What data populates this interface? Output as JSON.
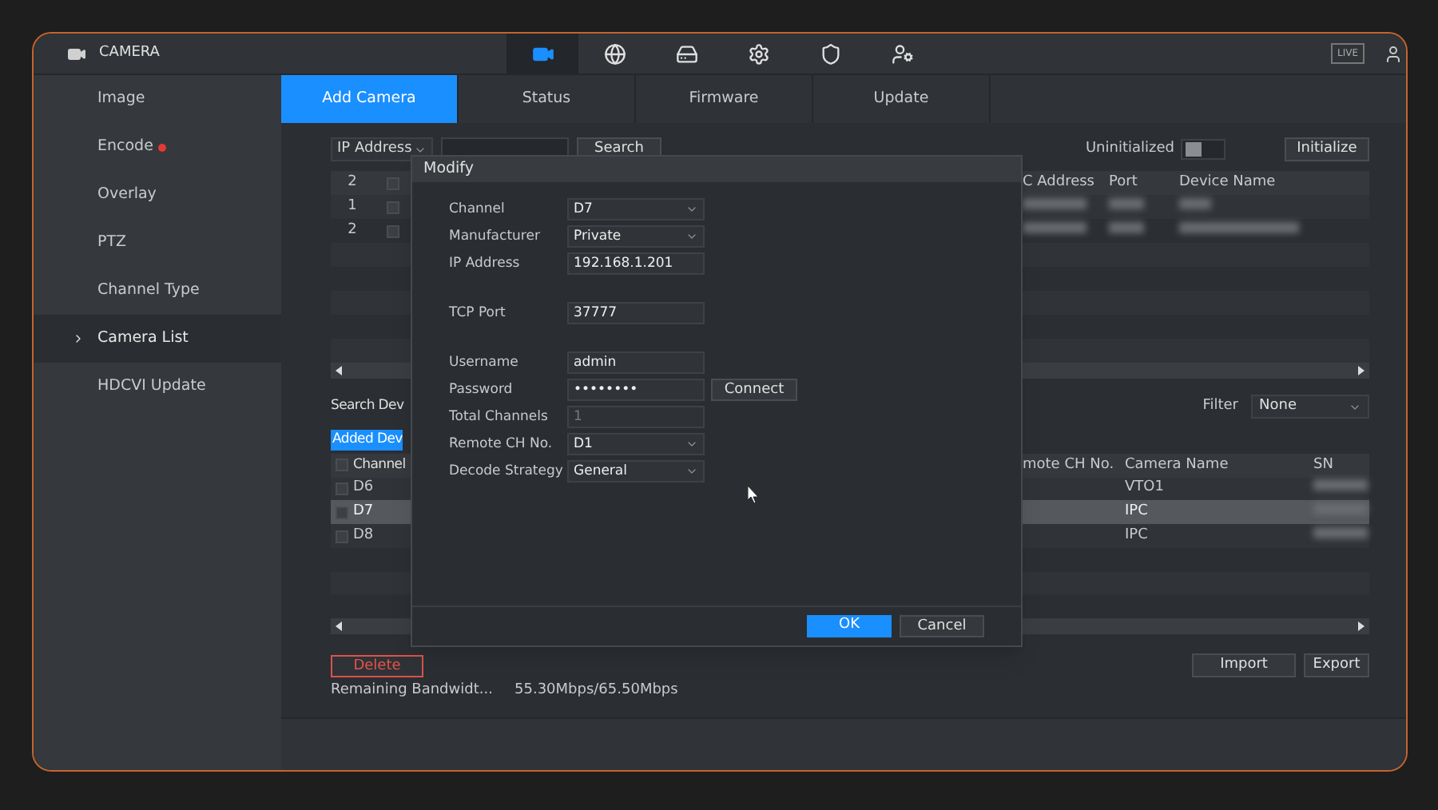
{
  "header": {
    "title": "CAMERA",
    "live_label": "LIVE",
    "nav": [
      {
        "selected": true
      },
      {
        "selected": false
      },
      {
        "selected": false
      },
      {
        "selected": false
      },
      {
        "selected": false
      },
      {
        "selected": false
      }
    ]
  },
  "sidebar": {
    "items": [
      {
        "label": "Image",
        "selected": false,
        "alert": false
      },
      {
        "label": "Encode",
        "selected": false,
        "alert": true
      },
      {
        "label": "Overlay",
        "selected": false,
        "alert": false
      },
      {
        "label": "PTZ",
        "selected": false,
        "alert": false
      },
      {
        "label": "Channel Type",
        "selected": false,
        "alert": false
      },
      {
        "label": "Camera List",
        "selected": true,
        "alert": false
      },
      {
        "label": "HDCVI Update",
        "selected": false,
        "alert": false
      }
    ]
  },
  "tabs": [
    {
      "label": "Add Camera",
      "selected": true
    },
    {
      "label": "Status",
      "selected": false
    },
    {
      "label": "Firmware",
      "selected": false
    },
    {
      "label": "Update",
      "selected": false
    }
  ],
  "search_bar": {
    "mode": "IP Address",
    "button": "Search",
    "uninitialized_label": "Uninitialized",
    "uninitialized_on": false,
    "initialize_button": "Initialize"
  },
  "found_table": {
    "count": "2",
    "all_checked": false,
    "columns": [
      "C Address",
      "Port",
      "Device Name"
    ],
    "rows": [
      {
        "index": "1",
        "checked": false
      },
      {
        "index": "2",
        "checked": false
      }
    ]
  },
  "added_section": {
    "label": "Search Dev",
    "filter_label": "Filter",
    "filter_value": "None",
    "tab_label": "Added Dev",
    "all_checked": false,
    "columns": [
      "Channel",
      "mote CH No.",
      "Camera Name",
      "SN"
    ],
    "rows": [
      {
        "channel": "D6",
        "camera_name": "VTO1",
        "selected": false,
        "checked": false
      },
      {
        "channel": "D7",
        "camera_name": "IPC",
        "selected": true,
        "checked": false
      },
      {
        "channel": "D8",
        "camera_name": "IPC",
        "selected": false,
        "checked": false
      }
    ]
  },
  "actions": {
    "delete": "Delete",
    "import": "Import",
    "export": "Export"
  },
  "bandwidth": {
    "label": "Remaining Bandwidt...",
    "value": "55.30Mbps/65.50Mbps"
  },
  "dialog": {
    "title": "Modify",
    "field_groups": [
      [
        {
          "label": "Channel",
          "kind": "select",
          "value": "D7"
        },
        {
          "label": "Manufacturer",
          "kind": "select",
          "value": "Private"
        },
        {
          "label": "IP Address",
          "kind": "input",
          "value": "192.168.1.201"
        }
      ],
      [
        {
          "label": "TCP Port",
          "kind": "input",
          "value": "37777"
        }
      ],
      [
        {
          "label": "Username",
          "kind": "input",
          "value": "admin"
        },
        {
          "label": "Password",
          "kind": "password",
          "value": "••••••••",
          "button": "Connect"
        },
        {
          "label": "Total Channels",
          "kind": "input",
          "value": "1",
          "disabled": true
        },
        {
          "label": "Remote CH No.",
          "kind": "select",
          "value": "D1"
        },
        {
          "label": "Decode Strategy",
          "kind": "select",
          "value": "General"
        }
      ]
    ],
    "buttons": [
      {
        "label": "OK",
        "primary": true
      },
      {
        "label": "Cancel",
        "primary": false
      }
    ]
  }
}
